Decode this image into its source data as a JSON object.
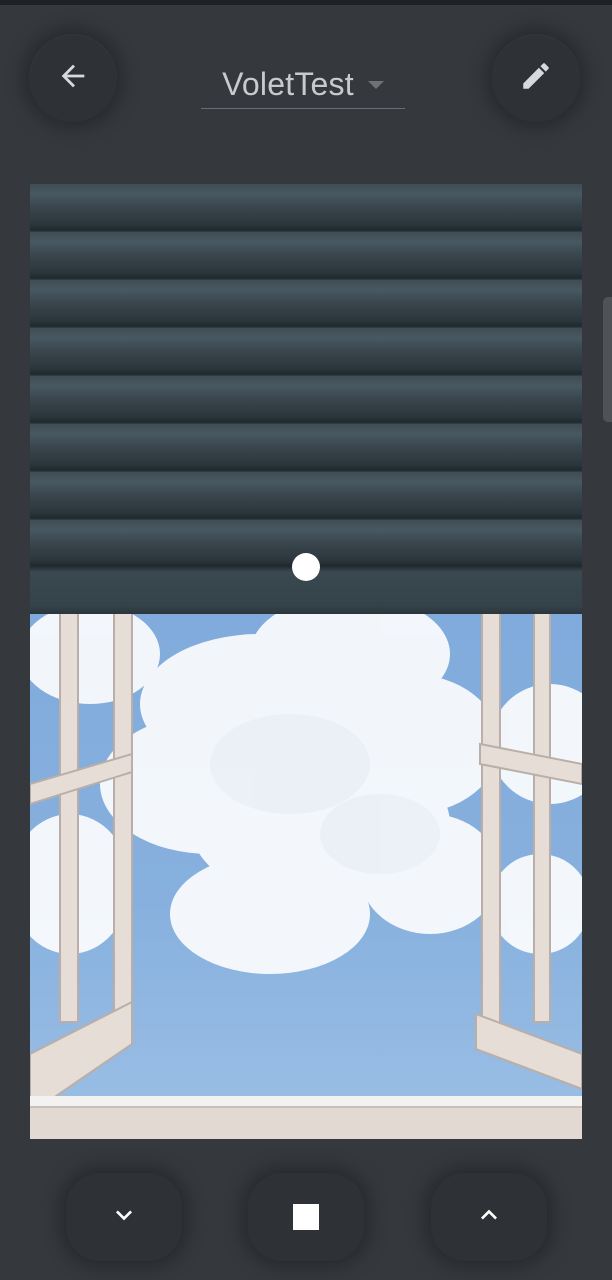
{
  "header": {
    "title": "VoletTest",
    "back_icon": "arrow-left-icon",
    "edit_icon": "pencil-icon",
    "dropdown_icon": "caret-down-icon"
  },
  "shutter": {
    "position_fraction": 0.45,
    "image": "window-with-clouds-and-rolling-shutter",
    "slider_icon": "slider-knob"
  },
  "controls": {
    "down_icon": "chevron-down-icon",
    "stop_icon": "stop-square-icon",
    "up_icon": "chevron-up-icon"
  },
  "colors": {
    "background": "#35383d",
    "button": "#2e3135",
    "icon": "#ffffff",
    "title": "#c8cacd"
  }
}
